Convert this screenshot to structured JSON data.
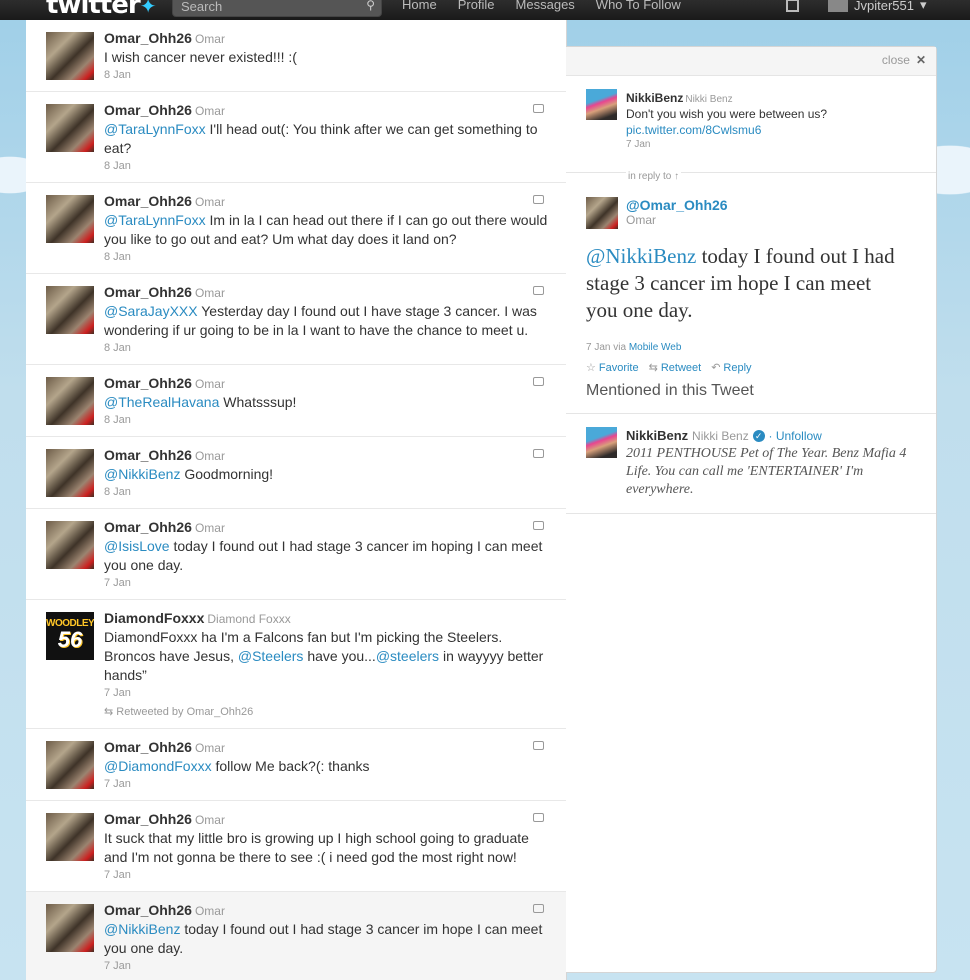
{
  "header": {
    "logo": "twitter",
    "search_placeholder": "Search",
    "nav": [
      "Home",
      "Profile",
      "Messages",
      "Who To Follow"
    ],
    "username": "Jvpiter551"
  },
  "timeline": [
    {
      "user": "Omar_Ohh26",
      "name": "Omar",
      "mention": "",
      "text": "I wish cancer never existed!!! :(",
      "time": "8 Jan",
      "avatar": "omar"
    },
    {
      "user": "Omar_Ohh26",
      "name": "Omar",
      "mention": "@TaraLynnFoxx",
      "text": " I'll head out(: You think after we can get something to eat?",
      "time": "8 Jan",
      "avatar": "omar"
    },
    {
      "user": "Omar_Ohh26",
      "name": "Omar",
      "mention": "@TaraLynnFoxx",
      "text": " Im in la I can head out there if I can go out there would you like to go out and eat? Um what day does it land on?",
      "time": "8 Jan",
      "avatar": "omar"
    },
    {
      "user": "Omar_Ohh26",
      "name": "Omar",
      "mention": "@SaraJayXXX",
      "text": " Yesterday day I found out I have stage 3 cancer. I was wondering if ur going to be in la I want to have the chance to meet u.",
      "time": "8 Jan",
      "avatar": "omar"
    },
    {
      "user": "Omar_Ohh26",
      "name": "Omar",
      "mention": "@TheRealHavana",
      "text": " Whatsssup!",
      "time": "8 Jan",
      "avatar": "omar"
    },
    {
      "user": "Omar_Ohh26",
      "name": "Omar",
      "mention": "@NikkiBenz",
      "text": " Goodmorning!",
      "time": "8 Jan",
      "avatar": "omar"
    },
    {
      "user": "Omar_Ohh26",
      "name": "Omar",
      "mention": "@IsisLove",
      "text": " today I found out I had stage 3 cancer im hoping I can meet you one day.",
      "time": "7 Jan",
      "avatar": "omar"
    },
    {
      "user": "DiamondFoxxx",
      "name": "Diamond Foxxx",
      "mention": "",
      "text": "DiamondFoxxx ha I'm a Falcons fan but I'm picking the Steelers. Broncos have Jesus, ",
      "mention2": "@Steelers",
      "text2": " have you...",
      "mention3": "@steelers",
      "text3": " in wayyyy better hands”",
      "time": "7 Jan",
      "retweeted_by": "Retweeted by Omar_Ohh26",
      "avatar": "diamond",
      "avatar_text1": "WOODLEY",
      "avatar_text2": "56"
    },
    {
      "user": "Omar_Ohh26",
      "name": "Omar",
      "mention": "@DiamondFoxxx",
      "text": " follow Me back?(: thanks",
      "time": "7 Jan",
      "avatar": "omar"
    },
    {
      "user": "Omar_Ohh26",
      "name": "Omar",
      "mention": "",
      "text": "It suck that my little bro is growing up I high school going to graduate and I'm not gonna be there to see :( i need god the most right now!",
      "time": "7 Jan",
      "avatar": "omar"
    },
    {
      "user": "Omar_Ohh26",
      "name": "Omar",
      "mention": "@NikkiBenz",
      "text": " today I found out I had stage 3 cancer im hope I can meet you one day.",
      "time": "7 Jan",
      "avatar": "omar",
      "highlight": true
    }
  ],
  "detail": {
    "close_label": "close",
    "parent": {
      "user": "NikkiBenz",
      "name": "Nikki Benz",
      "text": "Don't you wish you were between us?",
      "link": "pic.twitter.com/8Cwlsmu6",
      "time": "7 Jan"
    },
    "in_reply_to": "in reply to ↑",
    "main": {
      "user": "@Omar_Ohh26",
      "name": "Omar",
      "mention": "@NikkiBenz",
      "text": " today I found out I had stage 3 cancer im hope I can meet you one day.",
      "time": "7 Jan via",
      "via": "Mobile Web"
    },
    "actions": {
      "favorite": "Favorite",
      "retweet": "Retweet",
      "reply": "Reply"
    },
    "mentioned_heading": "Mentioned in this Tweet",
    "mentioned_user": {
      "user": "NikkiBenz",
      "name": "Nikki Benz",
      "unfollow": "· Unfollow",
      "bio": "2011 PENTHOUSE Pet of The Year. Benz Mafia 4 Life. You can call me 'ENTERTAINER' I'm everywhere."
    }
  },
  "colors": {
    "link": "#2a8bc1",
    "background": "#c0deed",
    "topbar": "#1f1f1f"
  }
}
